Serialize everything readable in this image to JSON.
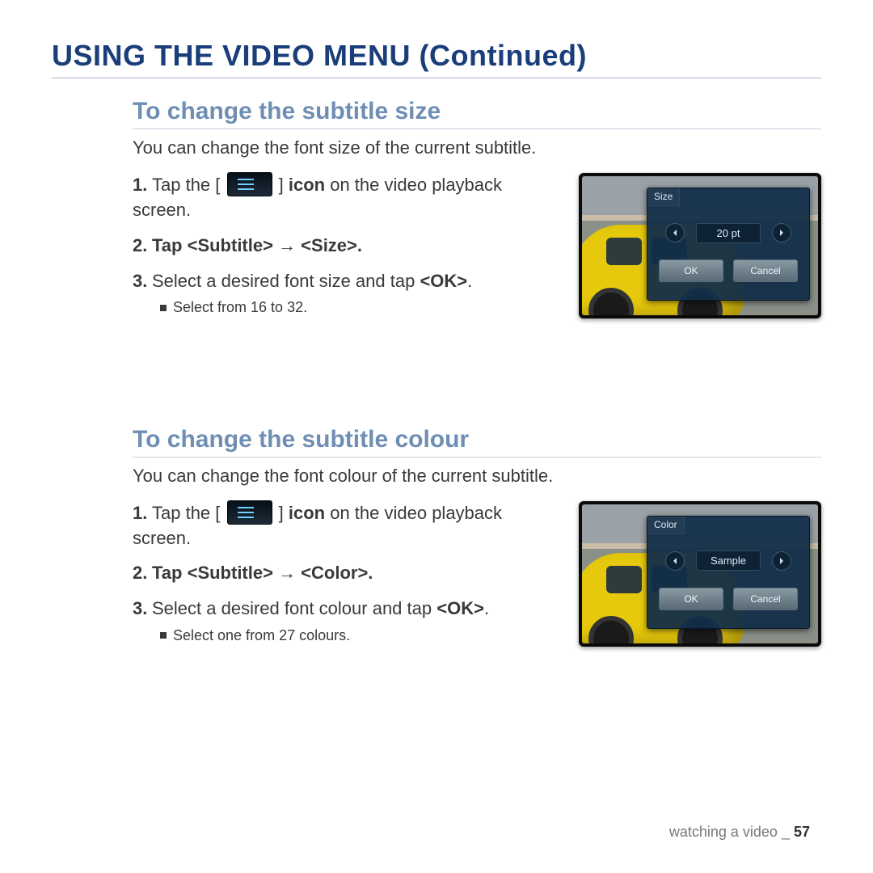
{
  "page_title": "USING THE VIDEO MENU (Continued)",
  "footer": {
    "label": "watching a video _ ",
    "page_num": "57"
  },
  "size_section": {
    "heading": "To change the subtitle size",
    "intro": "You can change the font size of the current subtitle.",
    "s1_a": "Tap the ",
    "s1_b": " icon",
    "s1_c": " on the video playback screen.",
    "s2": "Tap <Subtitle> → <Size>.",
    "s3_a": "Select a desired font size and tap ",
    "s3_b": "<OK>",
    "s3_c": ".",
    "bullet": "Select from 16 to 32.",
    "popup": {
      "title": "Size",
      "value": "20 pt",
      "ok": "OK",
      "cancel": "Cancel"
    }
  },
  "colour_section": {
    "heading": "To change the subtitle colour",
    "intro": "You can change the font colour of the current subtitle.",
    "s1_a": "Tap the ",
    "s1_b": " icon",
    "s1_c": " on the video playback screen.",
    "s2": "Tap <Subtitle> → <Color>.",
    "s3_a": "Select a desired font colour and tap ",
    "s3_b": "<OK>",
    "s3_c": ".",
    "bullet": "Select one from 27 colours.",
    "popup": {
      "title": "Color",
      "value": "Sample",
      "ok": "OK",
      "cancel": "Cancel"
    }
  }
}
